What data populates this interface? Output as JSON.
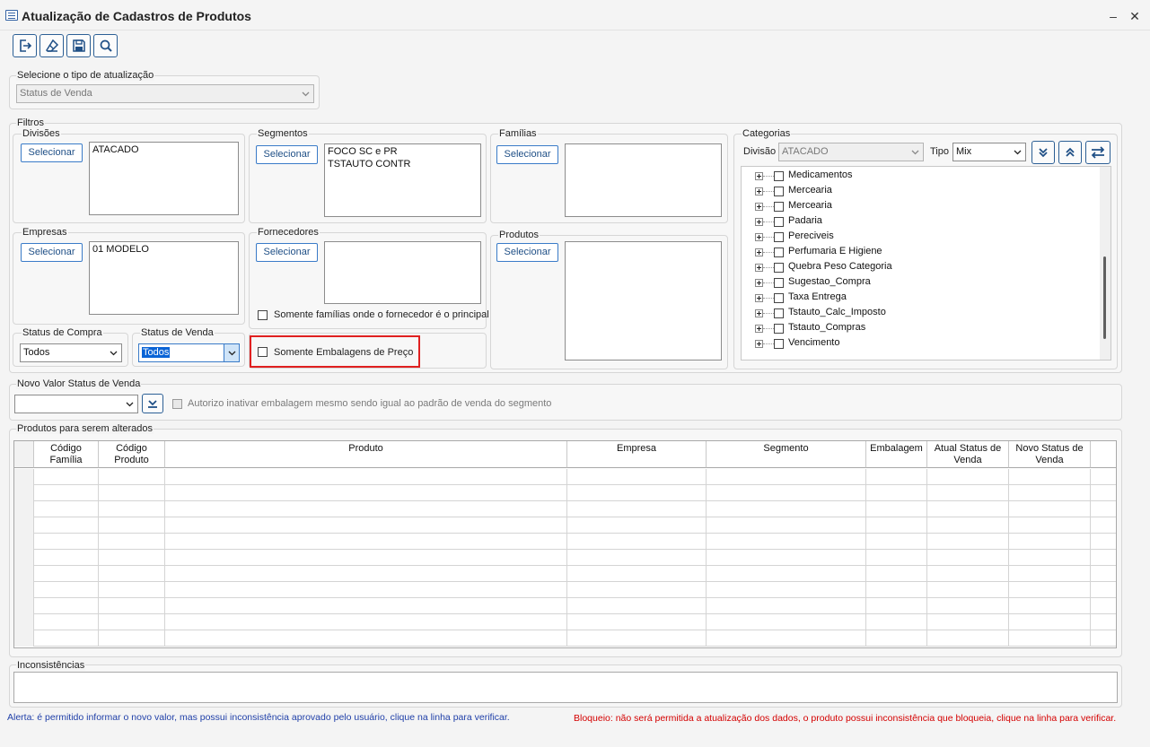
{
  "window": {
    "title": "Atualização de Cadastros de Produtos",
    "minimize": "–",
    "close": "✕"
  },
  "toolbar": [
    {
      "name": "exit-icon"
    },
    {
      "name": "eraser-icon"
    },
    {
      "name": "save-icon"
    },
    {
      "name": "search-icon"
    }
  ],
  "update_type": {
    "label": "Selecione o tipo de atualização",
    "value": "Status de Venda"
  },
  "filters": {
    "label": "Filtros",
    "divisoes": {
      "label": "Divisões",
      "button": "Selecionar",
      "items": [
        "ATACADO"
      ]
    },
    "segmentos": {
      "label": "Segmentos",
      "button": "Selecionar",
      "items": [
        "FOCO SC e PR",
        "TSTAUTO CONTR"
      ]
    },
    "familias": {
      "label": "Famílias",
      "button": "Selecionar",
      "items": []
    },
    "empresas": {
      "label": "Empresas",
      "button": "Selecionar",
      "items": [
        "01 MODELO"
      ]
    },
    "fornecedores": {
      "label": "Fornecedores",
      "button": "Selecionar",
      "items": [],
      "checkbox": "Somente famílias onde o fornecedor é o principal"
    },
    "produtos": {
      "label": "Produtos",
      "button": "Selecionar",
      "items": []
    },
    "status_compra": {
      "label": "Status de Compra",
      "value": "Todos"
    },
    "status_venda": {
      "label": "Status de Venda",
      "value": "Todos"
    },
    "embalagens_checkbox": "Somente Embalagens de Preço"
  },
  "categorias": {
    "label": "Categorias",
    "divisao_label": "Divisão",
    "divisao_value": "ATACADO",
    "tipo_label": "Tipo",
    "tipo_value": "Mix",
    "items": [
      "Medicamentos",
      "Mercearia",
      "Mercearia",
      "Padaria",
      "Pereciveis",
      "Perfumaria E Higiene",
      "Quebra Peso Categoria",
      "Sugestao_Compra",
      "Taxa Entrega",
      "Tstauto_Calc_Imposto",
      "Tstauto_Compras",
      "Vencimento"
    ]
  },
  "novo_valor": {
    "label": "Novo Valor Status de Venda",
    "value": "",
    "checkbox": "Autorizo inativar embalagem mesmo sendo igual ao padrão de venda do segmento"
  },
  "produtos_alterados": {
    "label": "Produtos para serem alterados",
    "columns": [
      "Código Família",
      "Código Produto",
      "Produto",
      "Empresa",
      "Segmento",
      "Embalagem",
      "Atual Status de Venda",
      "Novo Status de Venda"
    ],
    "row_count": 11
  },
  "inconsistencias": {
    "label": "Inconsistências"
  },
  "footer": {
    "alert": "Alerta: é permitido informar o novo valor, mas possui inconsistência aprovado pelo usuário, clique na linha para verificar.",
    "block": "Bloqueio: não será permitida a atualização dos dados, o produto possui inconsistência que bloqueia, clique na linha para verificar.",
    "alert_color": "#1f3fa8",
    "block_color": "#d40000"
  },
  "colors": {
    "accent": "#3a7bc8",
    "highlight_box": "#e02020",
    "selection": "#0a64d6"
  }
}
